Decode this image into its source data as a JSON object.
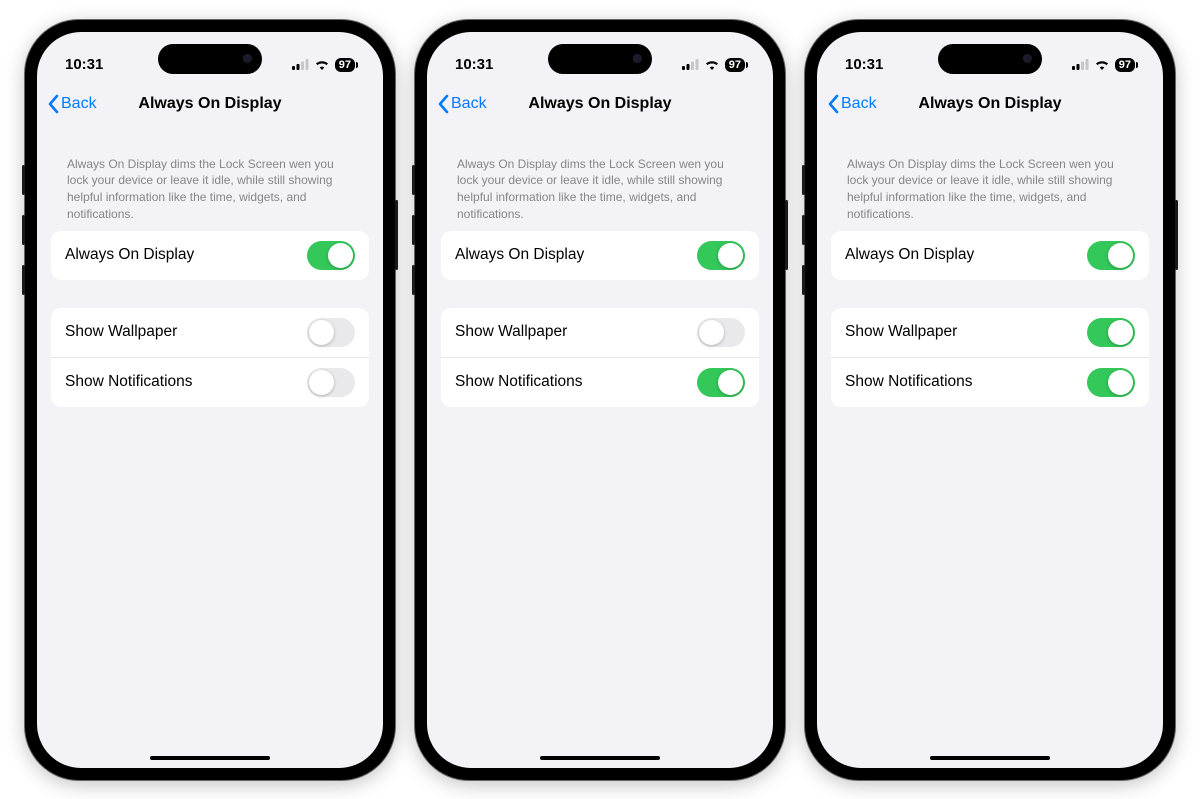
{
  "status": {
    "time": "10:31",
    "battery": "97"
  },
  "nav": {
    "back_label": "Back",
    "title": "Always On Display"
  },
  "description": "Always On Display dims the Lock Screen wen you lock your device or leave it idle, while still showing helpful information like the time, widgets, and notifications.",
  "rows": {
    "always_on": "Always On Display",
    "show_wallpaper": "Show Wallpaper",
    "show_notifications": "Show Notifications"
  },
  "phones": [
    {
      "always_on": true,
      "show_wallpaper": false,
      "show_notifications": false
    },
    {
      "always_on": true,
      "show_wallpaper": false,
      "show_notifications": true
    },
    {
      "always_on": true,
      "show_wallpaper": true,
      "show_notifications": true
    }
  ],
  "colors": {
    "accent": "#007aff",
    "toggle_on": "#34c759",
    "toggle_off": "#e9e9eb",
    "bg": "#f2f2f7"
  }
}
